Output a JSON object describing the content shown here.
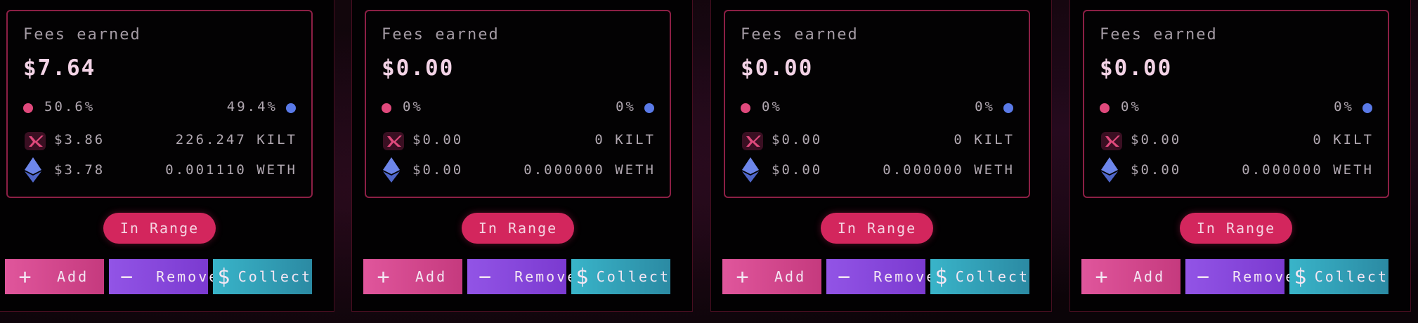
{
  "colors": {
    "accent_pink": "#d3265d",
    "kilt_dot": "#e0497c",
    "weth_dot": "#5a7ae8",
    "add_button": "#d94a90",
    "remove_button": "#8a49de",
    "collect_button": "#35a6bd"
  },
  "positions": [
    {
      "fees_label": "Fees earned",
      "fees_value": "$7.64",
      "kilt_pct": "50.6%",
      "weth_pct": "49.4%",
      "kilt_usd": "$3.86",
      "kilt_amount": "226.247 KILT",
      "weth_usd": "$3.78",
      "weth_amount": "0.001110 WETH",
      "status": "In Range",
      "add_label": "Add",
      "remove_label": "Remove",
      "collect_label": "Collect"
    },
    {
      "fees_label": "Fees earned",
      "fees_value": "$0.00",
      "kilt_pct": "0%",
      "weth_pct": "0%",
      "kilt_usd": "$0.00",
      "kilt_amount": "0 KILT",
      "weth_usd": "$0.00",
      "weth_amount": "0.000000 WETH",
      "status": "In Range",
      "add_label": "Add",
      "remove_label": "Remove",
      "collect_label": "Collect"
    },
    {
      "fees_label": "Fees earned",
      "fees_value": "$0.00",
      "kilt_pct": "0%",
      "weth_pct": "0%",
      "kilt_usd": "$0.00",
      "kilt_amount": "0 KILT",
      "weth_usd": "$0.00",
      "weth_amount": "0.000000 WETH",
      "status": "In Range",
      "add_label": "Add",
      "remove_label": "Remove",
      "collect_label": "Collect"
    },
    {
      "fees_label": "Fees earned",
      "fees_value": "$0.00",
      "kilt_pct": "0%",
      "weth_pct": "0%",
      "kilt_usd": "$0.00",
      "kilt_amount": "0 KILT",
      "weth_usd": "$0.00",
      "weth_amount": "0.000000 WETH",
      "status": "In Range",
      "add_label": "Add",
      "remove_label": "Remove",
      "collect_label": "Collect"
    }
  ],
  "icons": {
    "kilt": "kilt-logo-icon",
    "weth": "ethereum-icon",
    "add": "plus-icon",
    "remove": "minus-icon",
    "collect": "dollar-icon"
  }
}
